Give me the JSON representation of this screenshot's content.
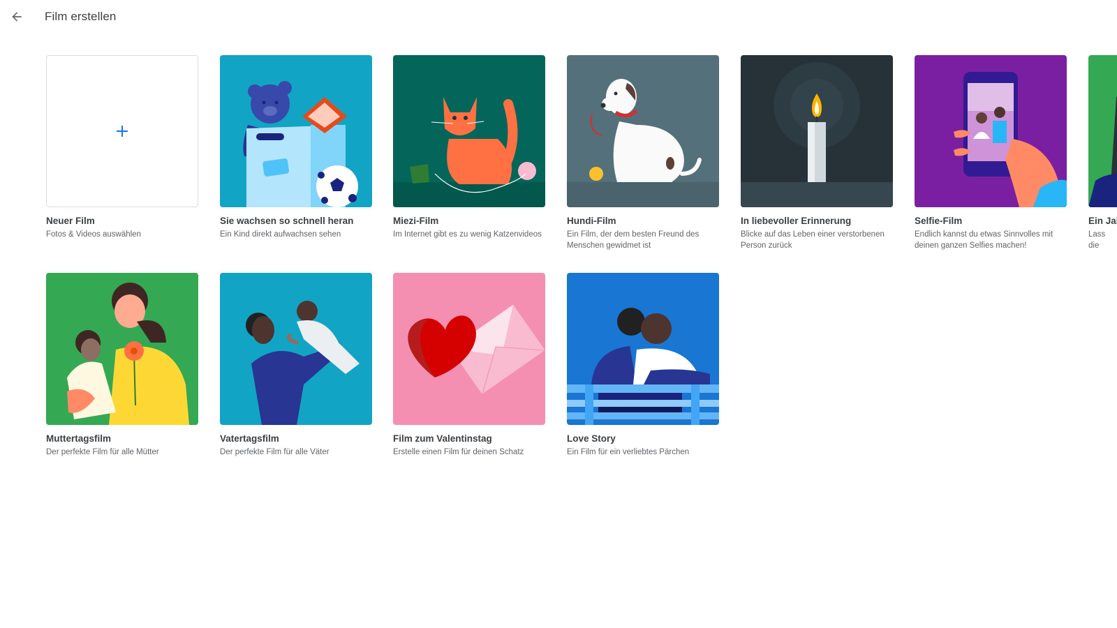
{
  "header": {
    "title": "Film erstellen",
    "back_icon": "arrow-back-icon"
  },
  "new_movie": {
    "title": "Neuer Film",
    "subtitle": "Fotos & Videos auswählen",
    "icon": "plus-icon",
    "accent": "#1a73e8"
  },
  "themes": [
    {
      "title": "Sie wachsen so schnell heran",
      "subtitle": "Ein Kind direkt aufwachsen sehen",
      "color": "#12a4c4"
    },
    {
      "title": "Miezi-Film",
      "subtitle": "Im Internet gibt es zu wenig Katzenvideos",
      "color": "#04665a"
    },
    {
      "title": "Hundi-Film",
      "subtitle": "Ein Film, der dem besten Freund des Menschen gewidmet ist",
      "color": "#54707a"
    },
    {
      "title": "In liebevoller Erinnerung",
      "subtitle": "Blicke auf das Leben einer verstorbenen Person zurück",
      "color": "#263238"
    },
    {
      "title": "Selfie-Film",
      "subtitle": "Endlich kannst du etwas Sinnvolles mit deinen ganzen Selfies machen!",
      "color": "#7b1fa2"
    },
    {
      "title": "Ein Jah Gesich",
      "subtitle": "Lass die",
      "color": "#34a853"
    },
    {
      "title": "Muttertagsfilm",
      "subtitle": "Der perfekte Film für alle Mütter",
      "color": "#34a853"
    },
    {
      "title": "Vatertagsfilm",
      "subtitle": "Der perfekte Film für alle Väter",
      "color": "#12a4c4"
    },
    {
      "title": "Film zum Valentinstag",
      "subtitle": "Erstelle einen Film für deinen Schatz",
      "color": "#f48fb1"
    },
    {
      "title": "Love Story",
      "subtitle": "Ein Film für ein verliebtes Pärchen",
      "color": "#1976d2"
    }
  ]
}
